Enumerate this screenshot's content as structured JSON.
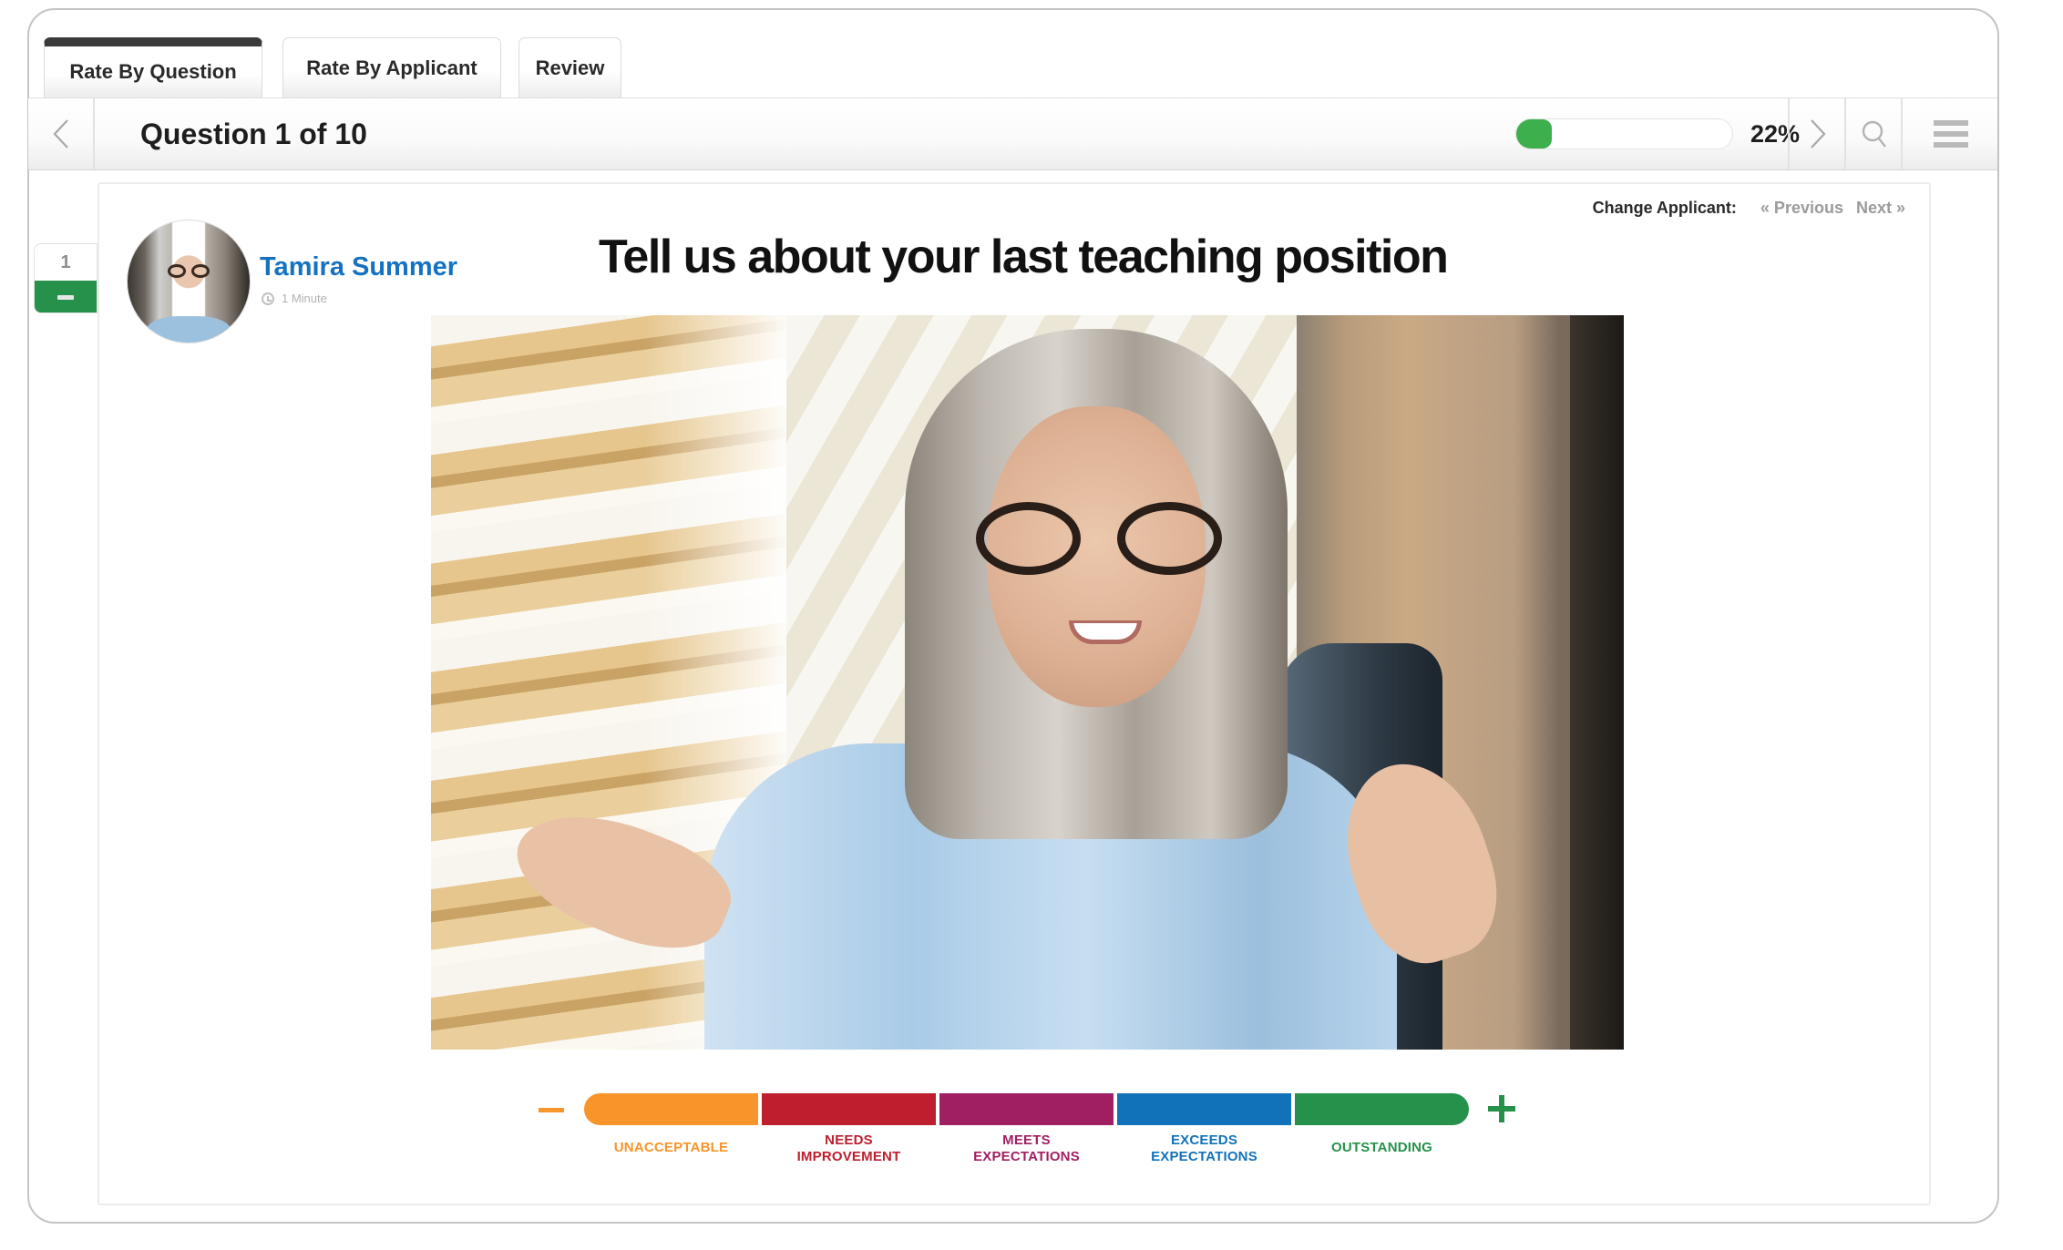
{
  "tabs": [
    {
      "label": "Rate By Question",
      "active": true
    },
    {
      "label": "Rate By Applicant",
      "active": false
    },
    {
      "label": "Review",
      "active": false
    }
  ],
  "toolbar": {
    "prev_icon": "chevron-left-icon",
    "title": "Question 1 of 10",
    "progress_percent": 22,
    "progress_label": "22%",
    "next_icon": "chevron-right-icon",
    "search_icon": "search-icon",
    "menu_icon": "hamburger-menu-icon",
    "progress_color": "#3daf4c"
  },
  "sidebar": {
    "question_number": "1",
    "status": "rated",
    "status_color": "#26914a"
  },
  "card": {
    "change_applicant_label": "Change Applicant:",
    "previous_link": "« Previous",
    "next_link": "Next »",
    "applicant": {
      "name": "Tamira Summer",
      "duration": "1 Minute",
      "name_color": "#1572c0"
    },
    "question": "Tell us about your last teaching position",
    "video": {
      "description": "Applicant video response still: gray-haired woman in glasses and light blue shirt, gesturing while speaking"
    }
  },
  "rating_scale": {
    "minus_label": "−",
    "plus_label": "+",
    "levels": [
      {
        "label": "UNACCEPTABLE",
        "lines": [
          "UNACCEPTABLE"
        ],
        "color": "#f7952a"
      },
      {
        "label": "NEEDS IMPROVEMENT",
        "lines": [
          "NEEDS",
          "IMPROVEMENT"
        ],
        "color": "#be1e2e"
      },
      {
        "label": "MEETS EXPECTATIONS",
        "lines": [
          "MEETS",
          "EXPECTATIONS"
        ],
        "color": "#a01f62"
      },
      {
        "label": "EXCEEDS EXPECTATIONS",
        "lines": [
          "EXCEEDS",
          "EXPECTATIONS"
        ],
        "color": "#1172b9"
      },
      {
        "label": "OUTSTANDING",
        "lines": [
          "OUTSTANDING"
        ],
        "color": "#26914a"
      }
    ]
  }
}
